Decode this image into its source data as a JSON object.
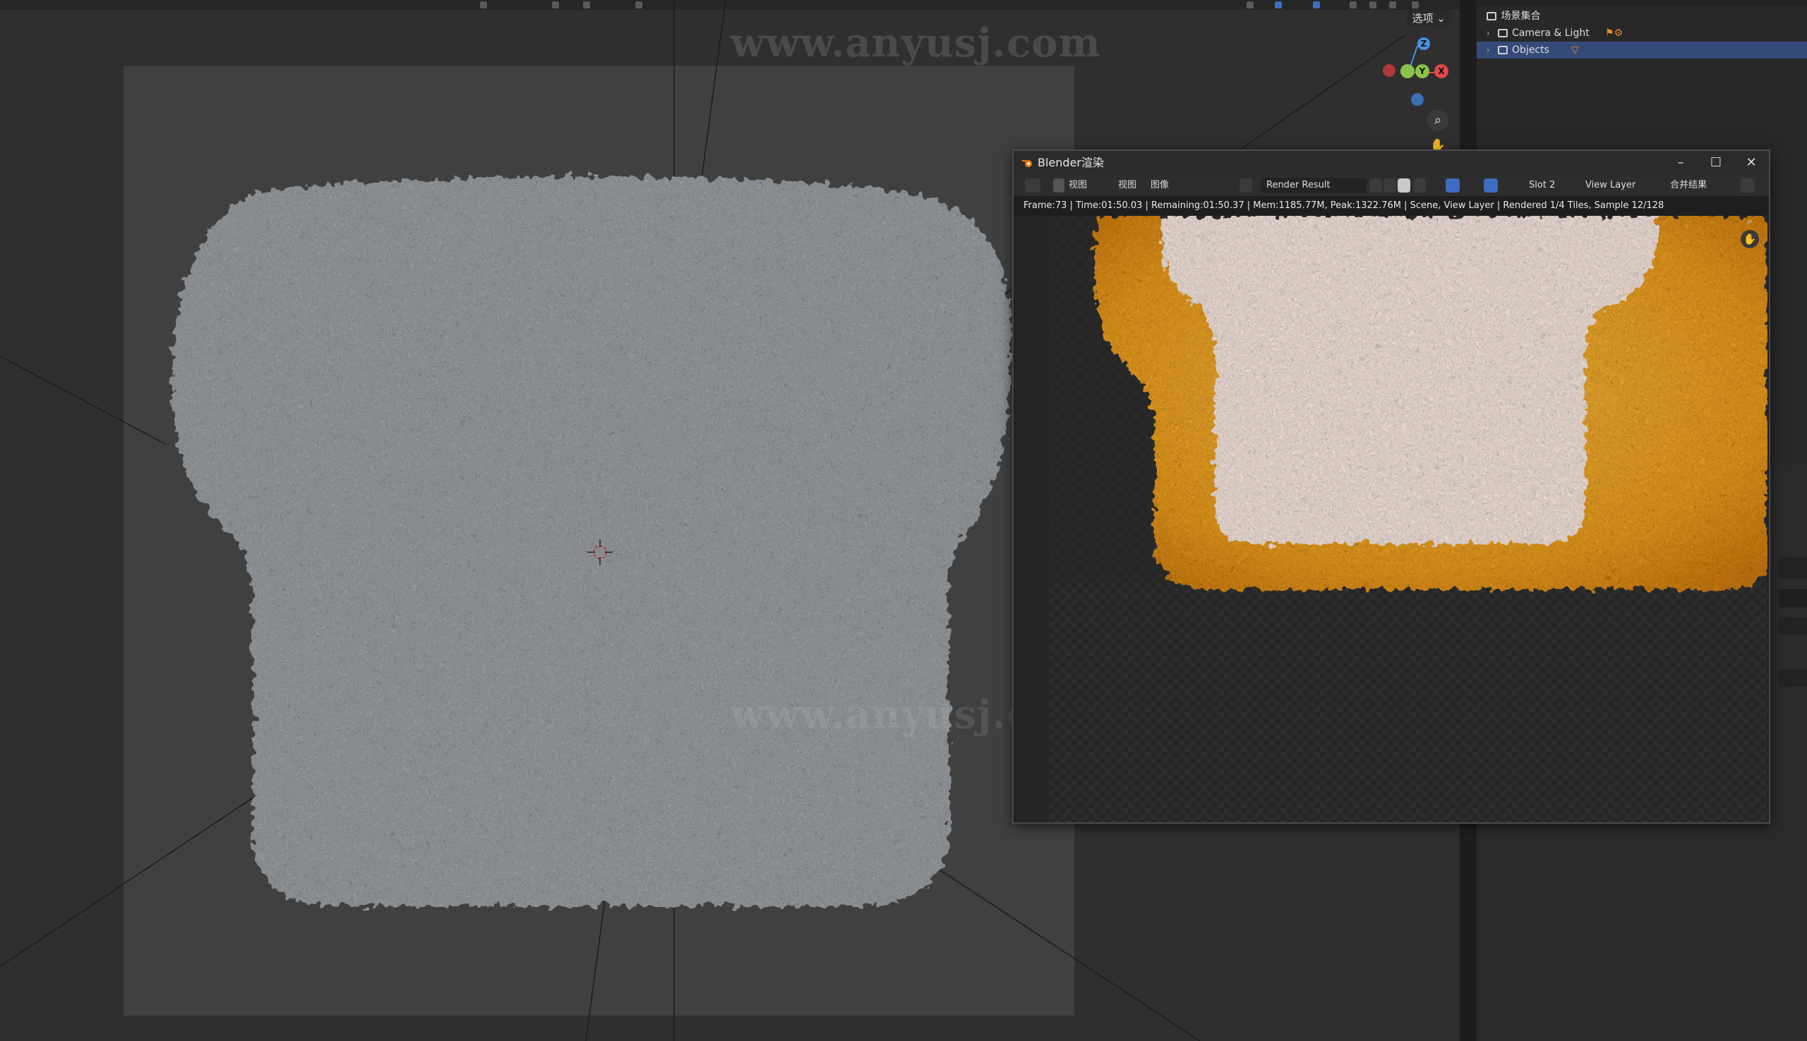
{
  "viewport": {
    "options_label": "选项 ⌄",
    "watermark_top": "www.anyusj.com",
    "watermark_mid": "www.anyusj.com",
    "gizmo": {
      "z_label": "Z",
      "y_label": "Y",
      "x_label": "X"
    },
    "icons": [
      "zoom-icon",
      "pan-hand-icon",
      "3d-cursor-icon"
    ]
  },
  "outliner": {
    "rows": [
      {
        "label": "场景集合",
        "icon": "scene-collection-icon"
      },
      {
        "label": "Camera & Light",
        "icon": "collection-icon"
      },
      {
        "label": "Objects",
        "icon": "collection-icon",
        "selected": true
      }
    ]
  },
  "render_window": {
    "title": "Blender渲染",
    "controls": {
      "minimize": "–",
      "maximize": "☐",
      "close": "✕"
    },
    "toolbar": {
      "view_menu": "视图",
      "view_menu2": "视图",
      "image_menu": "图像",
      "image_name": "Render Result",
      "slot": "Slot 2",
      "view_layer": "View Layer",
      "pass": "合并结果"
    },
    "status": "Frame:73 | Time:01:50.03 | Remaining:01:50.37 | Mem:1185.77M, Peak:1322.76M | Scene, View Layer | Rendered 1/4 Tiles, Sample 12/128"
  },
  "colors": {
    "viewport_bg": "#2f2f2f",
    "camera_frame": "#404040",
    "fur_gray": "#9a9fa3",
    "crust_orange": "#e69a1c",
    "crumb_cream": "#f4e4dc",
    "selection_blue": "#344a78",
    "axis_x": "#e0474c",
    "axis_y": "#8bc34a",
    "axis_z": "#4a8fe0"
  }
}
